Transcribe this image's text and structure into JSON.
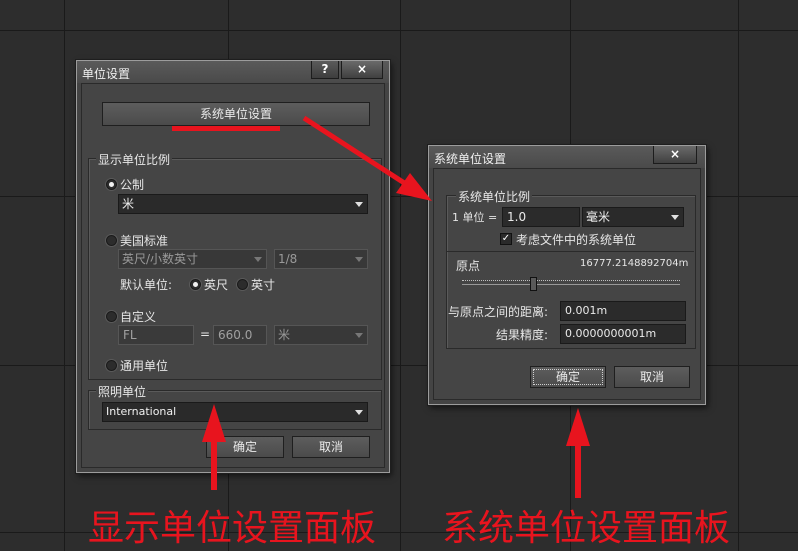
{
  "display_dialog": {
    "title": "单位设置",
    "help_button": "?",
    "close_button": "×",
    "system_unit_setup_button": "系统单位设置",
    "display_scale_group": "显示单位比例",
    "metric": {
      "label": "公制",
      "selected": true,
      "unit": "米"
    },
    "us_standard": {
      "label": "美国标准",
      "selected": false,
      "unit": "英尺/小数英寸",
      "fraction": "1/8",
      "default_unit_label": "默认单位:",
      "feet_label": "英尺",
      "inches_label": "英寸"
    },
    "custom": {
      "label": "自定义",
      "selected": false,
      "name": "FL",
      "equals": "=",
      "value": "660.0",
      "unit": "米"
    },
    "generic": {
      "label": "通用单位",
      "selected": false
    },
    "lighting_group": "照明单位",
    "lighting_value": "International",
    "ok_button": "确定",
    "cancel_button": "取消"
  },
  "system_dialog": {
    "title": "系统单位设置",
    "close_button": "×",
    "scale_group": "系统单位比例",
    "one_unit_label": "1 单位 =",
    "unit_value": "1.0",
    "unit_select": "毫米",
    "respect_label": "考虑文件中的系统单位",
    "respect_checked": "✓",
    "origin_label": "原点",
    "origin_value": "16777.2148892704m",
    "distance_label": "与原点之间的距离:",
    "distance_value": "0.001m",
    "precision_label": "结果精度:",
    "precision_value": "0.0000000001m",
    "ok_button": "确定",
    "cancel_button": "取消"
  },
  "annotations": {
    "left_caption": "显示单位设置面板",
    "right_caption": "系统单位设置面板",
    "color": "#e8141e"
  }
}
